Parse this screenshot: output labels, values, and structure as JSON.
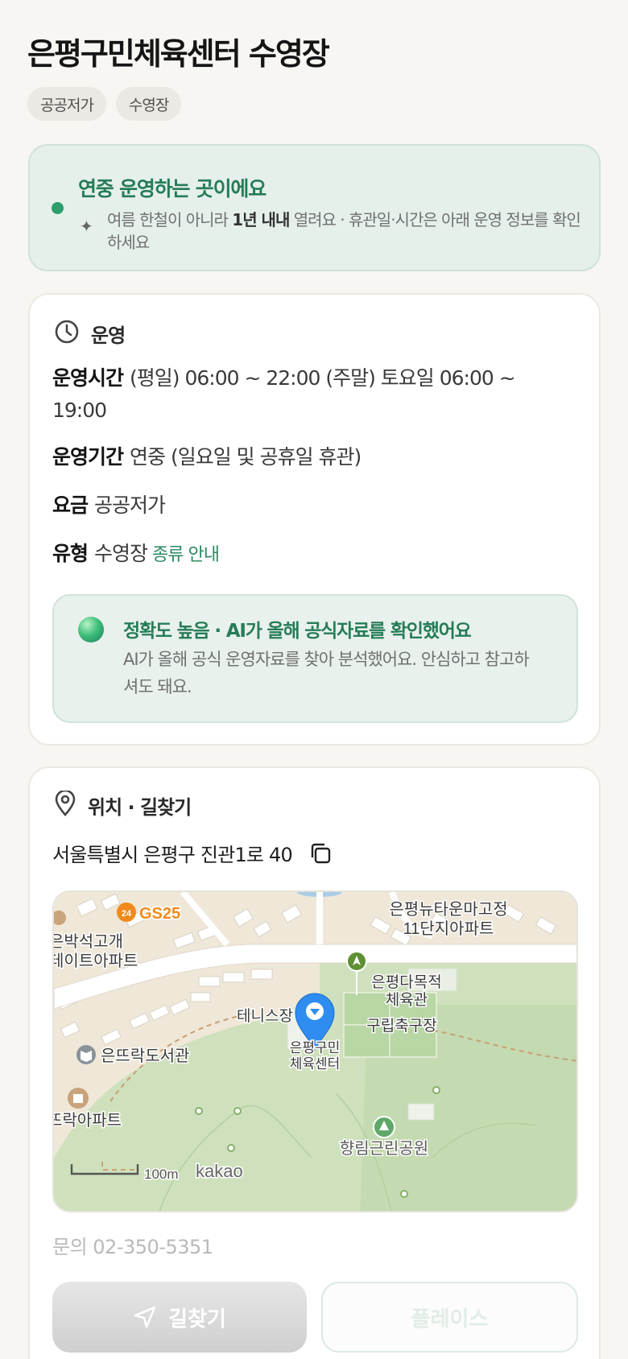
{
  "header": {
    "title": "은평구민체육센터 수영장",
    "tags": [
      "공공저가",
      "수영장"
    ]
  },
  "notice": {
    "title": "연중 운영하는 곳이에요",
    "desc_pre": "여름 한철이 아니라 ",
    "desc_bold": "1년 내내",
    "desc_post": " 열려요 · 휴관일·시간은 아래 운영 정보를 확인하세요"
  },
  "operation": {
    "section_title": "운영",
    "hours_label": "운영시간",
    "hours_value": "(평일) 06:00 ~ 22:00 (주말) 토요일 06:00 ~ 19:00",
    "period_label": "운영기간",
    "period_value": "연중 (일요일 및 공휴일 휴관)",
    "fee_label": "요금",
    "fee_value": "공공저가",
    "type_label": "유형",
    "type_value": "수영장",
    "type_link": "종류 안내",
    "ai": {
      "title": "정확도 높음 · AI가 올해 공식자료를 확인했어요",
      "desc": "AI가 올해 공식 운영자료를 찾아 분석했어요. 안심하고 참고하셔도 돼요."
    }
  },
  "location": {
    "section_title": "위치 · 길찾기",
    "address": "서울특별시 은평구 진관1로 40",
    "map": {
      "labels": {
        "gs25": "GS25",
        "apt_top_right_1": "은평뉴타운마고정",
        "apt_top_right_2": "11단지아파트",
        "apt_left_1": "은박석고개",
        "apt_left_2": "테이트아파트",
        "gym_1": "은평다목적",
        "gym_2": "체육관",
        "football": "구립축구장",
        "tennis": "테니스장",
        "center_1": "은평구민",
        "center_2": "체육센터",
        "library": "은뜨락도서관",
        "apt_bottom_left": "뜨락아파트",
        "park": "향림근린공원",
        "scale": "100m",
        "brand": "kakao"
      }
    },
    "contact": "문의 02-350-5351",
    "route_button": "길찾기",
    "place_button": "플레이스"
  },
  "colors": {
    "accent_green": "#267c57",
    "map_pin": "#2f8cf0",
    "gs25_orange": "#f08a1c"
  }
}
